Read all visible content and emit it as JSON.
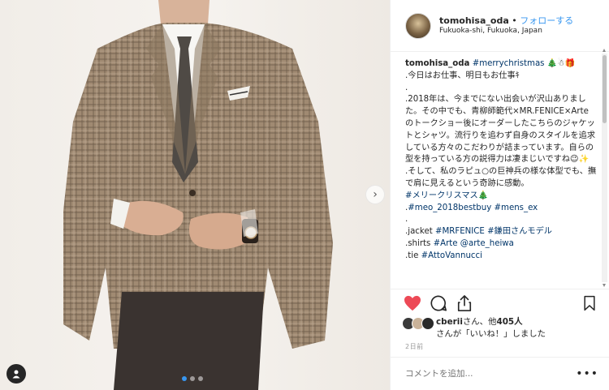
{
  "header": {
    "username": "tomohisa_oda",
    "separator": " • ",
    "follow_label": "フォローする",
    "location": "Fukuoka-shi, Fukuoka, Japan"
  },
  "caption": {
    "username": "tomohisa_oda",
    "first_tag": "#merrychristmas",
    "first_tail": " 🎄☃🎁",
    "lines": [
      ".今日はお仕事、明日もお仕事ｷ",
      ".",
      ".2018年は、今までにない出会いが沢山ありました。その中でも、青柳師範代×MR.FENICE×Arteのトークショー後にオーダーしたこちらのジャケットとシャツ。流行りを追わず自身のスタイルを追求している方々のこだわりが詰まっています。自らの型を持っている方の説得力は凄まじいですね😉✨",
      ".そして、私のラピュ○の巨神兵の様な体型でも、撫で肩に見えるという奇跡に感動。"
    ],
    "tag_line_1": "#メリークリスマス🎄",
    "tag_line_2a": "#meo_2018bestbuy",
    "tag_line_2b": "#mens_ex",
    "line_dot": ".",
    "jacket_prefix": ".jacket ",
    "jacket_tag1": "#MRFENICE",
    "jacket_tag2": "#鎌田さんモデル",
    "shirts_prefix": ".shirts ",
    "shirts_tag1": "#Arte",
    "shirts_tag2": "@arte_heiwa",
    "tie_prefix": ".tie ",
    "tie_tag": "#AttoVannucci"
  },
  "likes": {
    "name": "cberii",
    "text_mid": "さん、他",
    "count": "405人",
    "text_tail": "さんが「いいね！」しました"
  },
  "date": "2日前",
  "comment": {
    "placeholder": "コメントを追加...",
    "more_label": "•••"
  },
  "colors": {
    "link": "#3897f0",
    "heart": "#ed4956",
    "hashtag": "#003569"
  },
  "icons": {
    "like": "heart-icon",
    "comment": "comment-icon",
    "share": "share-icon",
    "save": "bookmark-icon",
    "next": "chevron-right-icon",
    "user_tag": "user-tag-icon"
  },
  "carousel": {
    "total": 3,
    "active": 1
  },
  "media": {
    "chevron": "›"
  }
}
